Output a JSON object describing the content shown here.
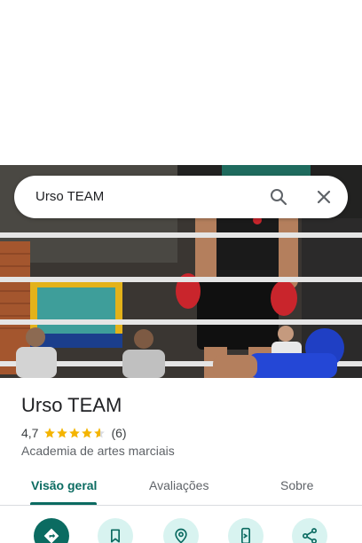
{
  "search": {
    "query": "Urso TEAM"
  },
  "place": {
    "name": "Urso TEAM",
    "rating": "4,7",
    "stars": 4.7,
    "reviews_count": "(6)",
    "category": "Academia de artes marciais"
  },
  "tabs": [
    {
      "label": "Visão geral",
      "active": true
    },
    {
      "label": "Avaliações",
      "active": false
    },
    {
      "label": "Sobre",
      "active": false
    }
  ],
  "actions": [
    {
      "icon": "directions-icon"
    },
    {
      "icon": "bookmark-icon"
    },
    {
      "icon": "nearby-icon"
    },
    {
      "icon": "send-to-phone-icon"
    },
    {
      "icon": "share-icon"
    }
  ],
  "colors": {
    "accent": "#0b6b61",
    "action_bg": "#d8f3f0",
    "star": "#f4b400",
    "glove_red": "#c9252c",
    "headgear_blue": "#1f3fc4"
  }
}
